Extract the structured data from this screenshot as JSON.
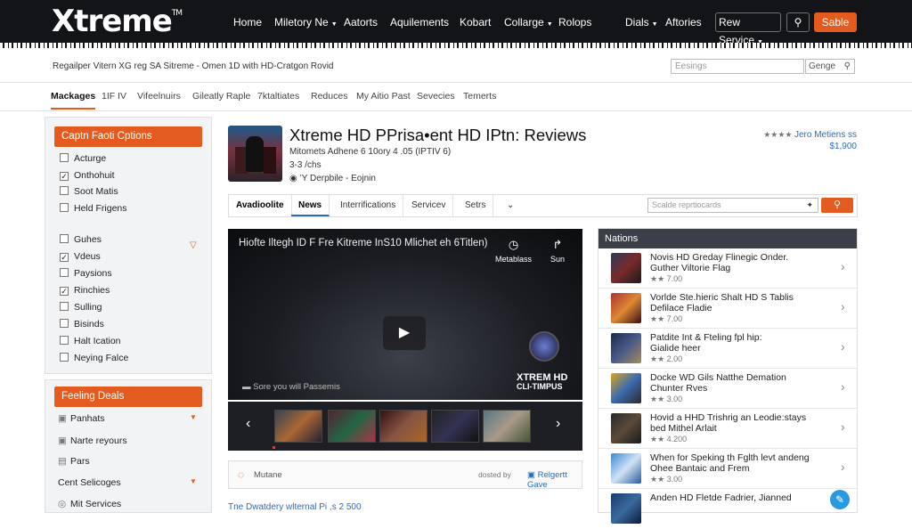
{
  "header": {
    "logo": "Xtreme",
    "logo_tm": "TM",
    "nav": [
      "Home",
      "Miletory Ne",
      "Aatorts",
      "Aquilements",
      "Kobart",
      "Collarge",
      "Rolops",
      "Dials",
      "Aftories"
    ],
    "new_service": "Rew Service",
    "sale": "Sable"
  },
  "breadcrumb": "Regailper Vitern XG reg SA Sitreme - Omen 1D with HD-Cratgon Rovid",
  "search": {
    "placeholder": "Eesings",
    "button": "Genge"
  },
  "subnav": [
    "Mackages",
    "1IF IV",
    "Vifeelnuirs",
    "Gileatly Raple",
    "7ktaltiates",
    "Reduces",
    "My Aitio Past",
    "Sevecies",
    "Temerts"
  ],
  "sidebar": {
    "options_title": "Captn Faoti Cptions",
    "options": [
      {
        "label": "Acturge",
        "checked": false
      },
      {
        "label": "Onthohuit",
        "checked": true
      },
      {
        "label": "Soot Matis",
        "checked": false
      },
      {
        "label": "Held Frigens",
        "checked": false
      },
      {
        "label": "Guhes",
        "checked": false
      },
      {
        "label": "Vdeus",
        "checked": true
      },
      {
        "label": "Paysions",
        "checked": false
      },
      {
        "label": "Rinchies",
        "checked": true
      },
      {
        "label": "Sulling",
        "checked": false
      },
      {
        "label": "Bisinds",
        "checked": false
      },
      {
        "label": "Halt Ication",
        "checked": false
      },
      {
        "label": "Neying Falce",
        "checked": false
      }
    ],
    "deals_title": "Feeling Deals",
    "deals": [
      "Panhats",
      "Narte reyours",
      "Pars",
      "Cent Selicoges",
      "Mit Services"
    ]
  },
  "product": {
    "title": "Xtreme HD PPrisa•ent HD IPtn: Reviews",
    "meta1": "Mitomets Adhene    6 10ory 4 .05 (IPTIV 6)",
    "meta2": "3-3 /chs",
    "meta3": "’Y Derpbile  - Eojnin",
    "rating_label": "Jero  Metiens ss",
    "price": "$1,900"
  },
  "tabs": [
    "Avadioolite",
    "News",
    "Interrifications",
    "Servicev",
    "Setrs"
  ],
  "tab_search_placeholder": "Scalde reprtiocards",
  "video": {
    "title": "Hiofte Iltegh ID F Fre Kitreme InS10 Mlichet eh 6Titlen)",
    "icon1_label": "Metablass",
    "icon2_label": "Sun",
    "caption": "Sore you will Passemis",
    "brand_line1": "XTREM HD",
    "brand_line2": "CLI-TIMPUS"
  },
  "infobar": {
    "text": "Mutane",
    "label": "dosted by",
    "link": "Relgertt Gave"
  },
  "footer_link": "Tne Dwatdery wlternal Pi ,s 2 500",
  "related": {
    "title": "Nations",
    "items": [
      {
        "line1": "Novis HD Greday Flinegic Onder.",
        "line2": "Guther Viltorie Flag",
        "rating": "★★ 7.00"
      },
      {
        "line1": "Vorlde Ste.hieric Shalt HD S Tablis",
        "line2": "Defilace Fladie",
        "rating": "★★ 7.00"
      },
      {
        "line1": "Patdite Int & Fteling fpl hip:",
        "line2": "Gialide heer",
        "rating": "★★ 2.00"
      },
      {
        "line1": "Docke WD Gils Natthe Demation",
        "line2": "Chunter Rves",
        "rating": "★★ 3.00"
      },
      {
        "line1": "Hovid a HHD Trishrig an Leodie:stays",
        "line2": "bed Mithel Arlait",
        "rating": "★★ 4.200"
      },
      {
        "line1": "When for Speking th Fglth levt andeng",
        "line2": "Ohee Bantaic and Frem",
        "rating": "★★ 3.00"
      },
      {
        "line1": "Anden HD Fletde Fadrier, Jianned",
        "line2": "",
        "rating": ""
      }
    ]
  },
  "colors": {
    "accent": "#e35b1f",
    "topbar": "#121417",
    "link": "#2a6db5"
  }
}
